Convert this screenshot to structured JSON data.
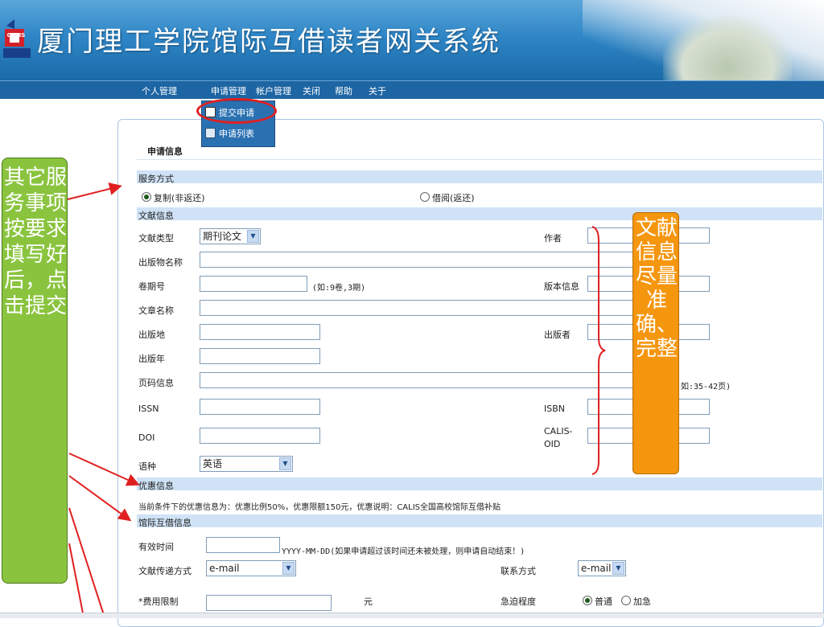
{
  "header": {
    "title": "厦门理工学院馆际互借读者网关系统",
    "logo_text": "CALIS"
  },
  "nav": {
    "items": [
      "个人管理",
      "申请管理",
      "帐户管理",
      "关闭",
      "帮助",
      "关于"
    ]
  },
  "dropdown": {
    "items": [
      "提交申请",
      "申请列表"
    ]
  },
  "panel": {
    "title": "申请信息"
  },
  "service": {
    "section": "服务方式",
    "option_copy": "复制(非返还)",
    "option_loan": "借阅(返还)",
    "selected": "复制(非返还)"
  },
  "doc": {
    "section": "文献信息",
    "type_label": "文献类型",
    "type_value": "期刊论文",
    "author_label": "作者",
    "publication_label": "出版物名称",
    "volume_label": "卷期号",
    "volume_hint": "(如:9卷,3期)",
    "edition_label": "版本信息",
    "article_label": "文章名称",
    "place_label": "出版地",
    "publisher_label": "出版者",
    "year_label": "出版年",
    "pages_label": "页码信息",
    "pages_hint": "如:35-42页)",
    "issn_label": "ISSN",
    "isbn_label": "ISBN",
    "doi_label": "DOI",
    "calis_label_1": "CALIS-",
    "calis_label_2": "OID",
    "lang_label": "语种",
    "lang_value": "英语"
  },
  "discount": {
    "section": "优惠信息",
    "text": "当前条件下的优惠信息为：优惠比例50%，优惠限额150元，优惠说明：CALIS全国高校馆际互借补贴"
  },
  "ill": {
    "section": "馆际互借信息",
    "valid_label": "有效时间",
    "valid_hint": "YYYY-MM-DD(如果申请超过该时间还未被处理，则申请自动结束！)",
    "delivery_label": "文献传递方式",
    "delivery_value": "e-mail",
    "contact_label": "联系方式",
    "contact_value": "e-mail",
    "fee_label": "*费用限制",
    "fee_unit": "元",
    "urgency_label": "急迫程度",
    "urgency_normal": "普通",
    "urgency_rush": "加急",
    "urgency_selected": "普通"
  },
  "callouts": {
    "left": "其它服务事项按要求填写好后，点击提交",
    "right": "文献信息尽量准确、完整"
  },
  "colors": {
    "header": "#2f86c6",
    "nav": "#1d65a3",
    "section": "#cfe2f6",
    "callout_left": "#8ac43f",
    "callout_right": "#f5960f",
    "arrow": "#e02020"
  },
  "icons": [
    "calis-logo-icon",
    "checkbox-icon",
    "search-list-icon",
    "chevron-down-icon",
    "radio-icon"
  ]
}
